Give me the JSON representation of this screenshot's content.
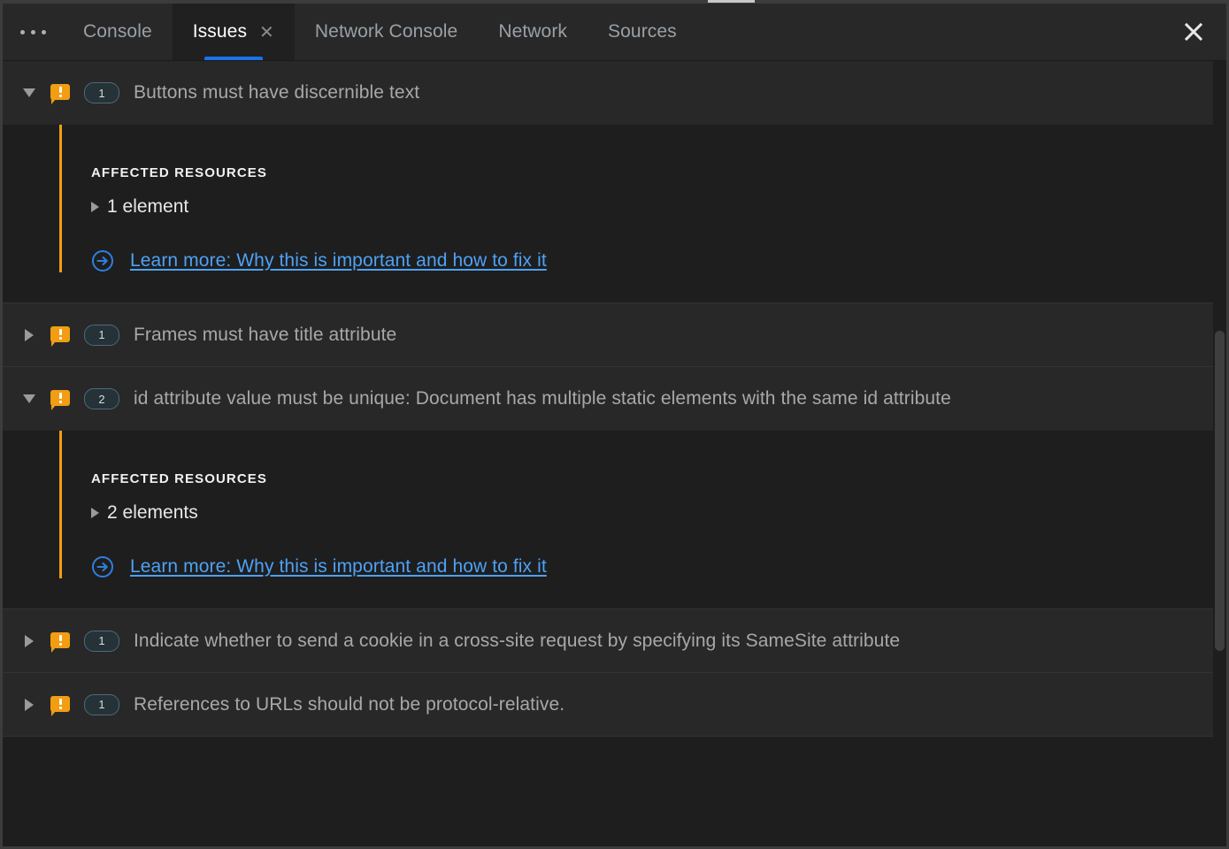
{
  "window": {
    "close_label": "close-panel"
  },
  "tabbar": {
    "more_tabs_label": "More tabs",
    "tabs": [
      {
        "label": "Console",
        "active": false,
        "closable": false
      },
      {
        "label": "Issues",
        "active": true,
        "closable": true,
        "close_glyph": "✕"
      },
      {
        "label": "Network Console",
        "active": false,
        "closable": false
      },
      {
        "label": "Network",
        "active": false,
        "closable": false
      },
      {
        "label": "Sources",
        "active": false,
        "closable": false
      }
    ],
    "active_tab": "Issues",
    "accent_color": "#1a73e8"
  },
  "issues": [
    {
      "title": "Buttons must have discernible text",
      "count": "1",
      "severity": "warning",
      "expanded": true,
      "section_label": "AFFECTED RESOURCES",
      "resource_text": "1 element",
      "learn_more": "Learn more: Why this is important and how to fix it"
    },
    {
      "title": "Frames must have title attribute",
      "count": "1",
      "severity": "warning",
      "expanded": false
    },
    {
      "title": "id attribute value must be unique: Document has multiple static elements with the same id attribute",
      "count": "2",
      "severity": "warning",
      "expanded": true,
      "section_label": "AFFECTED RESOURCES",
      "resource_text": "2 elements",
      "learn_more": "Learn more: Why this is important and how to fix it"
    },
    {
      "title": "Indicate whether to send a cookie in a cross-site request by specifying its SameSite attribute",
      "count": "1",
      "severity": "warning",
      "expanded": false
    },
    {
      "title": "References to URLs should not be protocol-relative.",
      "count": "1",
      "severity": "warning",
      "expanded": false
    }
  ],
  "colors": {
    "warning": "#f29d12",
    "link": "#4ea1f5",
    "accent": "#1a73e8",
    "panel_bg": "#1e1e1e",
    "row_bg": "#282828"
  },
  "scrollbar": {
    "thumb_top_px": "305",
    "thumb_height_px": "362"
  }
}
